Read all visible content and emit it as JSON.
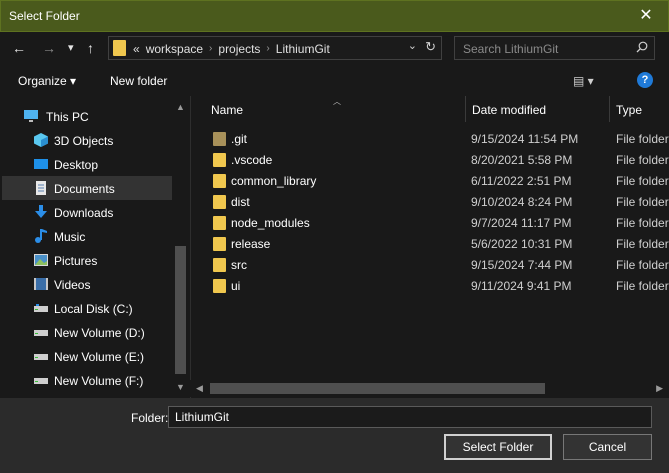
{
  "window": {
    "title": "Select Folder",
    "close_glyph": "✕"
  },
  "nav": {
    "back_glyph": "←",
    "forward_glyph": "→",
    "recent_glyph": "▾",
    "up_glyph": "↑"
  },
  "address": {
    "overflow": "«",
    "crumbs": [
      "workspace",
      "projects",
      "LithiumGit"
    ],
    "crumb_sep": "›",
    "dropdown_glyph": "⌄",
    "refresh_glyph": "↻"
  },
  "search": {
    "placeholder": "Search LithiumGit"
  },
  "toolbar": {
    "organize_label": "Organize ▾",
    "new_folder_label": "New folder",
    "view_glyph": "▤ ▾",
    "help_glyph": "?"
  },
  "sidebar": {
    "items": [
      {
        "label": "This PC",
        "icon": "monitor-icon"
      },
      {
        "label": "3D Objects",
        "icon": "cube-icon"
      },
      {
        "label": "Desktop",
        "icon": "desktop-icon"
      },
      {
        "label": "Documents",
        "icon": "document-icon",
        "selected": true
      },
      {
        "label": "Downloads",
        "icon": "download-icon"
      },
      {
        "label": "Music",
        "icon": "music-icon"
      },
      {
        "label": "Pictures",
        "icon": "picture-icon"
      },
      {
        "label": "Videos",
        "icon": "video-icon"
      },
      {
        "label": "Local Disk (C:)",
        "icon": "drive-icon"
      },
      {
        "label": "New Volume (D:)",
        "icon": "drive-icon"
      },
      {
        "label": "New Volume (E:)",
        "icon": "drive-icon"
      },
      {
        "label": "New Volume (F:)",
        "icon": "drive-icon"
      }
    ]
  },
  "files": {
    "columns": {
      "name": "Name",
      "date": "Date modified",
      "type": "Type"
    },
    "rows": [
      {
        "name": ".git",
        "date": "9/15/2024 11:54 PM",
        "type": "File folder"
      },
      {
        "name": ".vscode",
        "date": "8/20/2021 5:58 PM",
        "type": "File folder"
      },
      {
        "name": "common_library",
        "date": "6/11/2022 2:51 PM",
        "type": "File folder"
      },
      {
        "name": "dist",
        "date": "9/10/2024 8:24 PM",
        "type": "File folder"
      },
      {
        "name": "node_modules",
        "date": "9/7/2024 11:17 PM",
        "type": "File folder"
      },
      {
        "name": "release",
        "date": "5/6/2022 10:31 PM",
        "type": "File folder"
      },
      {
        "name": "src",
        "date": "9/15/2024 7:44 PM",
        "type": "File folder"
      },
      {
        "name": "ui",
        "date": "9/11/2024 9:41 PM",
        "type": "File folder"
      }
    ]
  },
  "footer": {
    "folder_label": "Folder:",
    "folder_value": "LithiumGit",
    "select_label": "Select Folder",
    "cancel_label": "Cancel"
  },
  "colors": {
    "titlebar": "#4a5a1c",
    "folder": "#f0c74e",
    "help": "#1f7ad8"
  }
}
